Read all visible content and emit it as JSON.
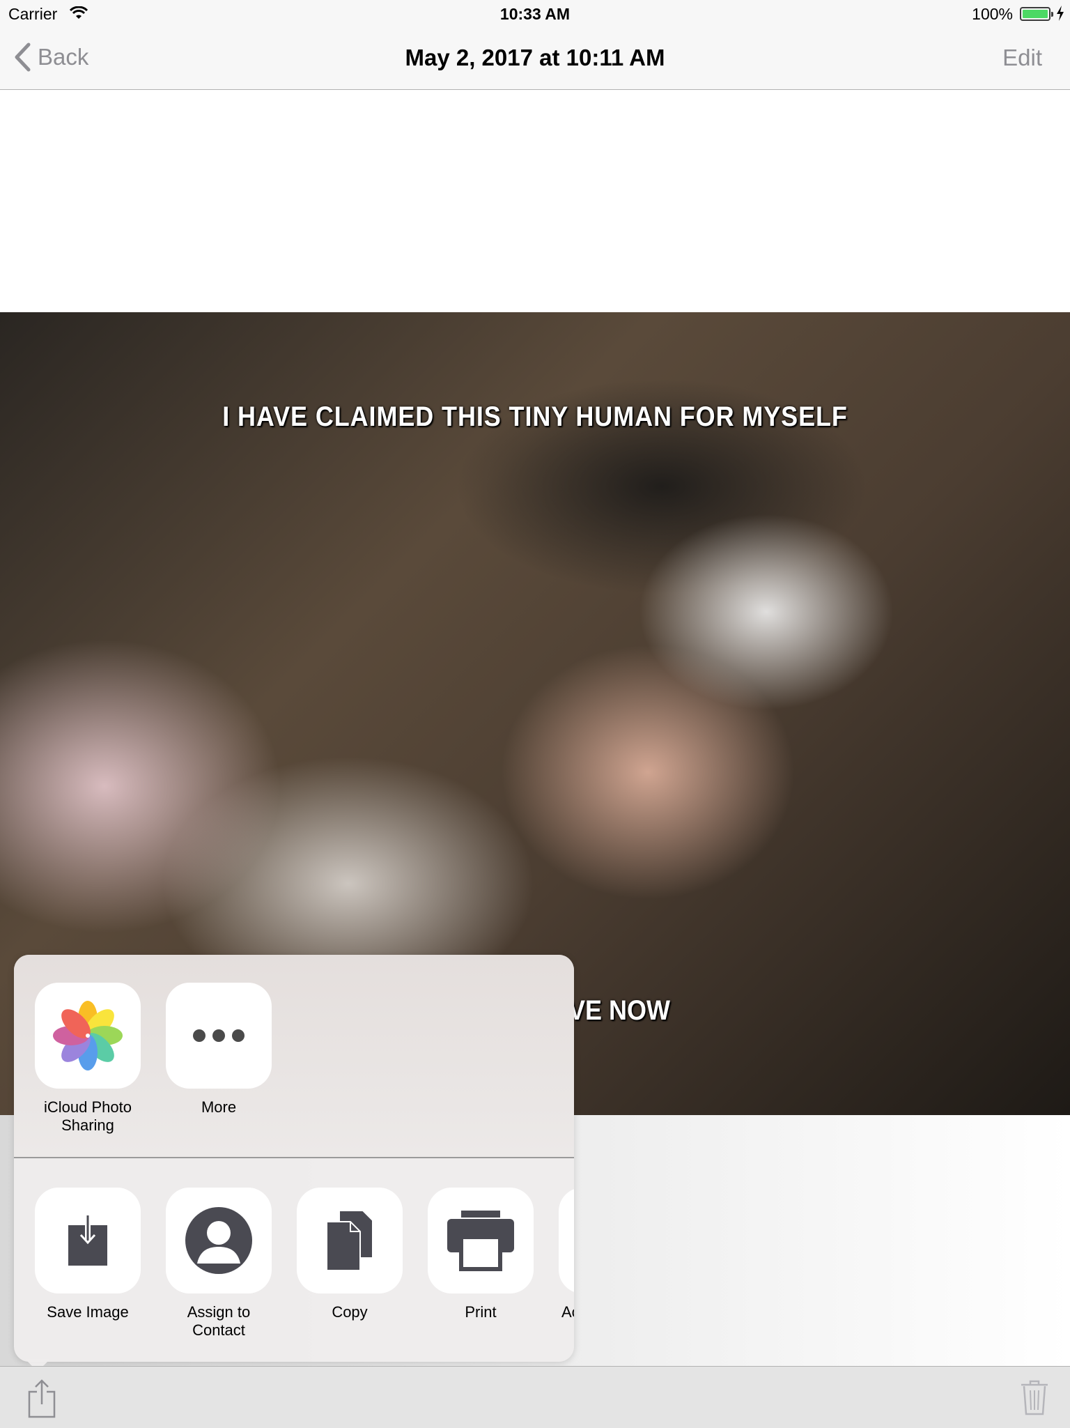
{
  "status_bar": {
    "carrier": "Carrier",
    "time": "10:33 AM",
    "battery": "100%"
  },
  "nav": {
    "back_label": "Back",
    "title": "May 2, 2017 at 10:11 AM",
    "edit_label": "Edit"
  },
  "photo": {
    "caption_top": "I HAVE CLAIMED THIS TINY HUMAN FOR MYSELF",
    "caption_bottom_visible": "VE NOW"
  },
  "share_sheet": {
    "apps": [
      {
        "label": "iCloud Photo Sharing",
        "icon": "photos-icon"
      },
      {
        "label": "More",
        "icon": "more-icon"
      }
    ],
    "actions": [
      {
        "label": "Save Image",
        "icon": "save-image-icon"
      },
      {
        "label": "Assign to Contact",
        "icon": "contact-icon"
      },
      {
        "label": "Copy",
        "icon": "copy-icon"
      },
      {
        "label": "Print",
        "icon": "print-icon"
      },
      {
        "label": "Ac",
        "icon": "partial-action-icon"
      }
    ]
  },
  "toolbar": {
    "share": "share-icon",
    "trash": "trash-icon"
  },
  "colors": {
    "battery": "#4cd964",
    "nav_gray": "#8e8e93"
  }
}
